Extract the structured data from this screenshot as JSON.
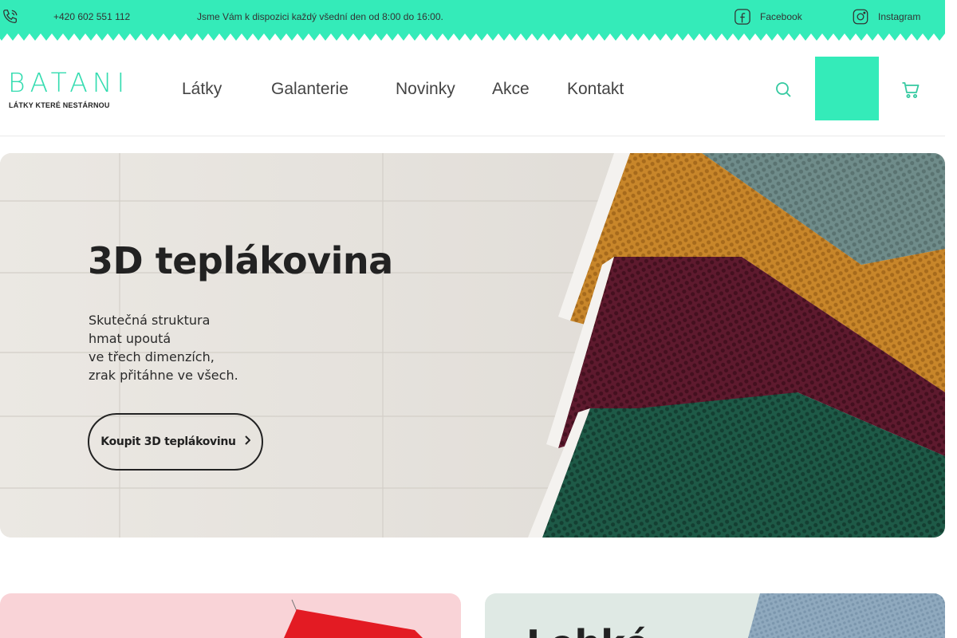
{
  "topbar": {
    "phone": "+420 602 551 112",
    "hours": "Jsme Vám k dispozici každý všední den od 8:00 do 16:00.",
    "facebook_label": "Facebook",
    "instagram_label": "Instagram",
    "accent_color": "#34ebb9"
  },
  "header": {
    "logo_text": "BATANI",
    "logo_tagline": "LÁTKY KTERÉ NESTÁRNOU",
    "nav": [
      {
        "label": "Látky",
        "has_dropdown": true
      },
      {
        "label": "Galanterie",
        "has_dropdown": true
      },
      {
        "label": "Novinky",
        "has_dropdown": false
      },
      {
        "label": "Akce",
        "has_dropdown": false
      },
      {
        "label": "Kontakt",
        "has_dropdown": false
      }
    ],
    "dropdown_glyph": "",
    "account_glyph": ""
  },
  "hero": {
    "title": "3D teplákovina",
    "lines": [
      "Skutečná struktura",
      "hmat upoutá",
      "ve třech dimenzích,",
      "zrak přitáhne ve všech."
    ],
    "cta_label": "Koupit 3D teplákovinu",
    "fabric_colors": [
      "#c8862a",
      "#5e1a2e",
      "#1e5a47",
      "#6f8c8a"
    ]
  },
  "cards": {
    "right_text": "Lehké"
  }
}
